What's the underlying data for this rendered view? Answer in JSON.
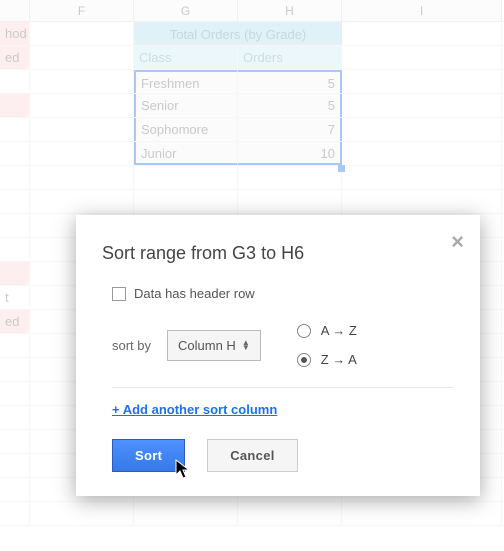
{
  "columns": {
    "E": "",
    "F": "F",
    "G": "G",
    "H": "H",
    "I": "I"
  },
  "fragments": {
    "hod": "hod",
    "ed": "ed",
    "t": "t"
  },
  "table": {
    "title": "Total Orders (by Grade)",
    "headers": {
      "class": "Class",
      "orders": "Orders"
    },
    "rows": [
      {
        "class": "Freshmen",
        "orders": "5"
      },
      {
        "class": "Senior",
        "orders": "5"
      },
      {
        "class": "Sophomore",
        "orders": "7"
      },
      {
        "class": "Junior",
        "orders": "10"
      }
    ]
  },
  "dialog": {
    "title": "Sort range from G3 to H6",
    "header_checkbox_label": "Data has header row",
    "sort_by_label": "sort by",
    "column_select": "Column H",
    "order_asc": "A → Z",
    "order_desc": "Z → A",
    "add_link": "+ Add another sort column",
    "sort_btn": "Sort",
    "cancel_btn": "Cancel"
  }
}
